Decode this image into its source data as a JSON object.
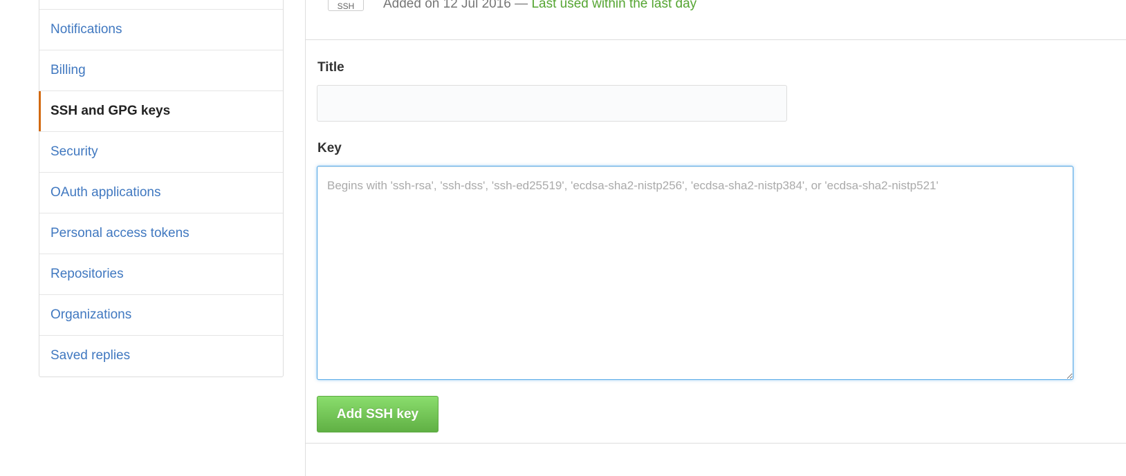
{
  "sidebar": {
    "items": [
      {
        "label": "Notifications",
        "selected": false
      },
      {
        "label": "Billing",
        "selected": false
      },
      {
        "label": "SSH and GPG keys",
        "selected": true
      },
      {
        "label": "Security",
        "selected": false
      },
      {
        "label": "OAuth applications",
        "selected": false
      },
      {
        "label": "Personal access tokens",
        "selected": false
      },
      {
        "label": "Repositories",
        "selected": false
      },
      {
        "label": "Organizations",
        "selected": false
      },
      {
        "label": "Saved replies",
        "selected": false
      }
    ]
  },
  "existing_key": {
    "badge": "SSH",
    "added_text": "Added on 12 Jul 2016 — ",
    "last_used_text": "Last used within the last day"
  },
  "form": {
    "title_label": "Title",
    "title_value": "",
    "key_label": "Key",
    "key_value": "",
    "key_placeholder": "Begins with 'ssh-rsa', 'ssh-dss', 'ssh-ed25519', 'ecdsa-sha2-nistp256', 'ecdsa-sha2-nistp384', or 'ecdsa-sha2-nistp521'",
    "submit_label": "Add SSH key"
  },
  "colors": {
    "link": "#4078c0",
    "selected_indicator": "#d26911",
    "recent_green": "#55a532",
    "button_green": "#60b044",
    "focus_blue": "#51a7e8"
  }
}
